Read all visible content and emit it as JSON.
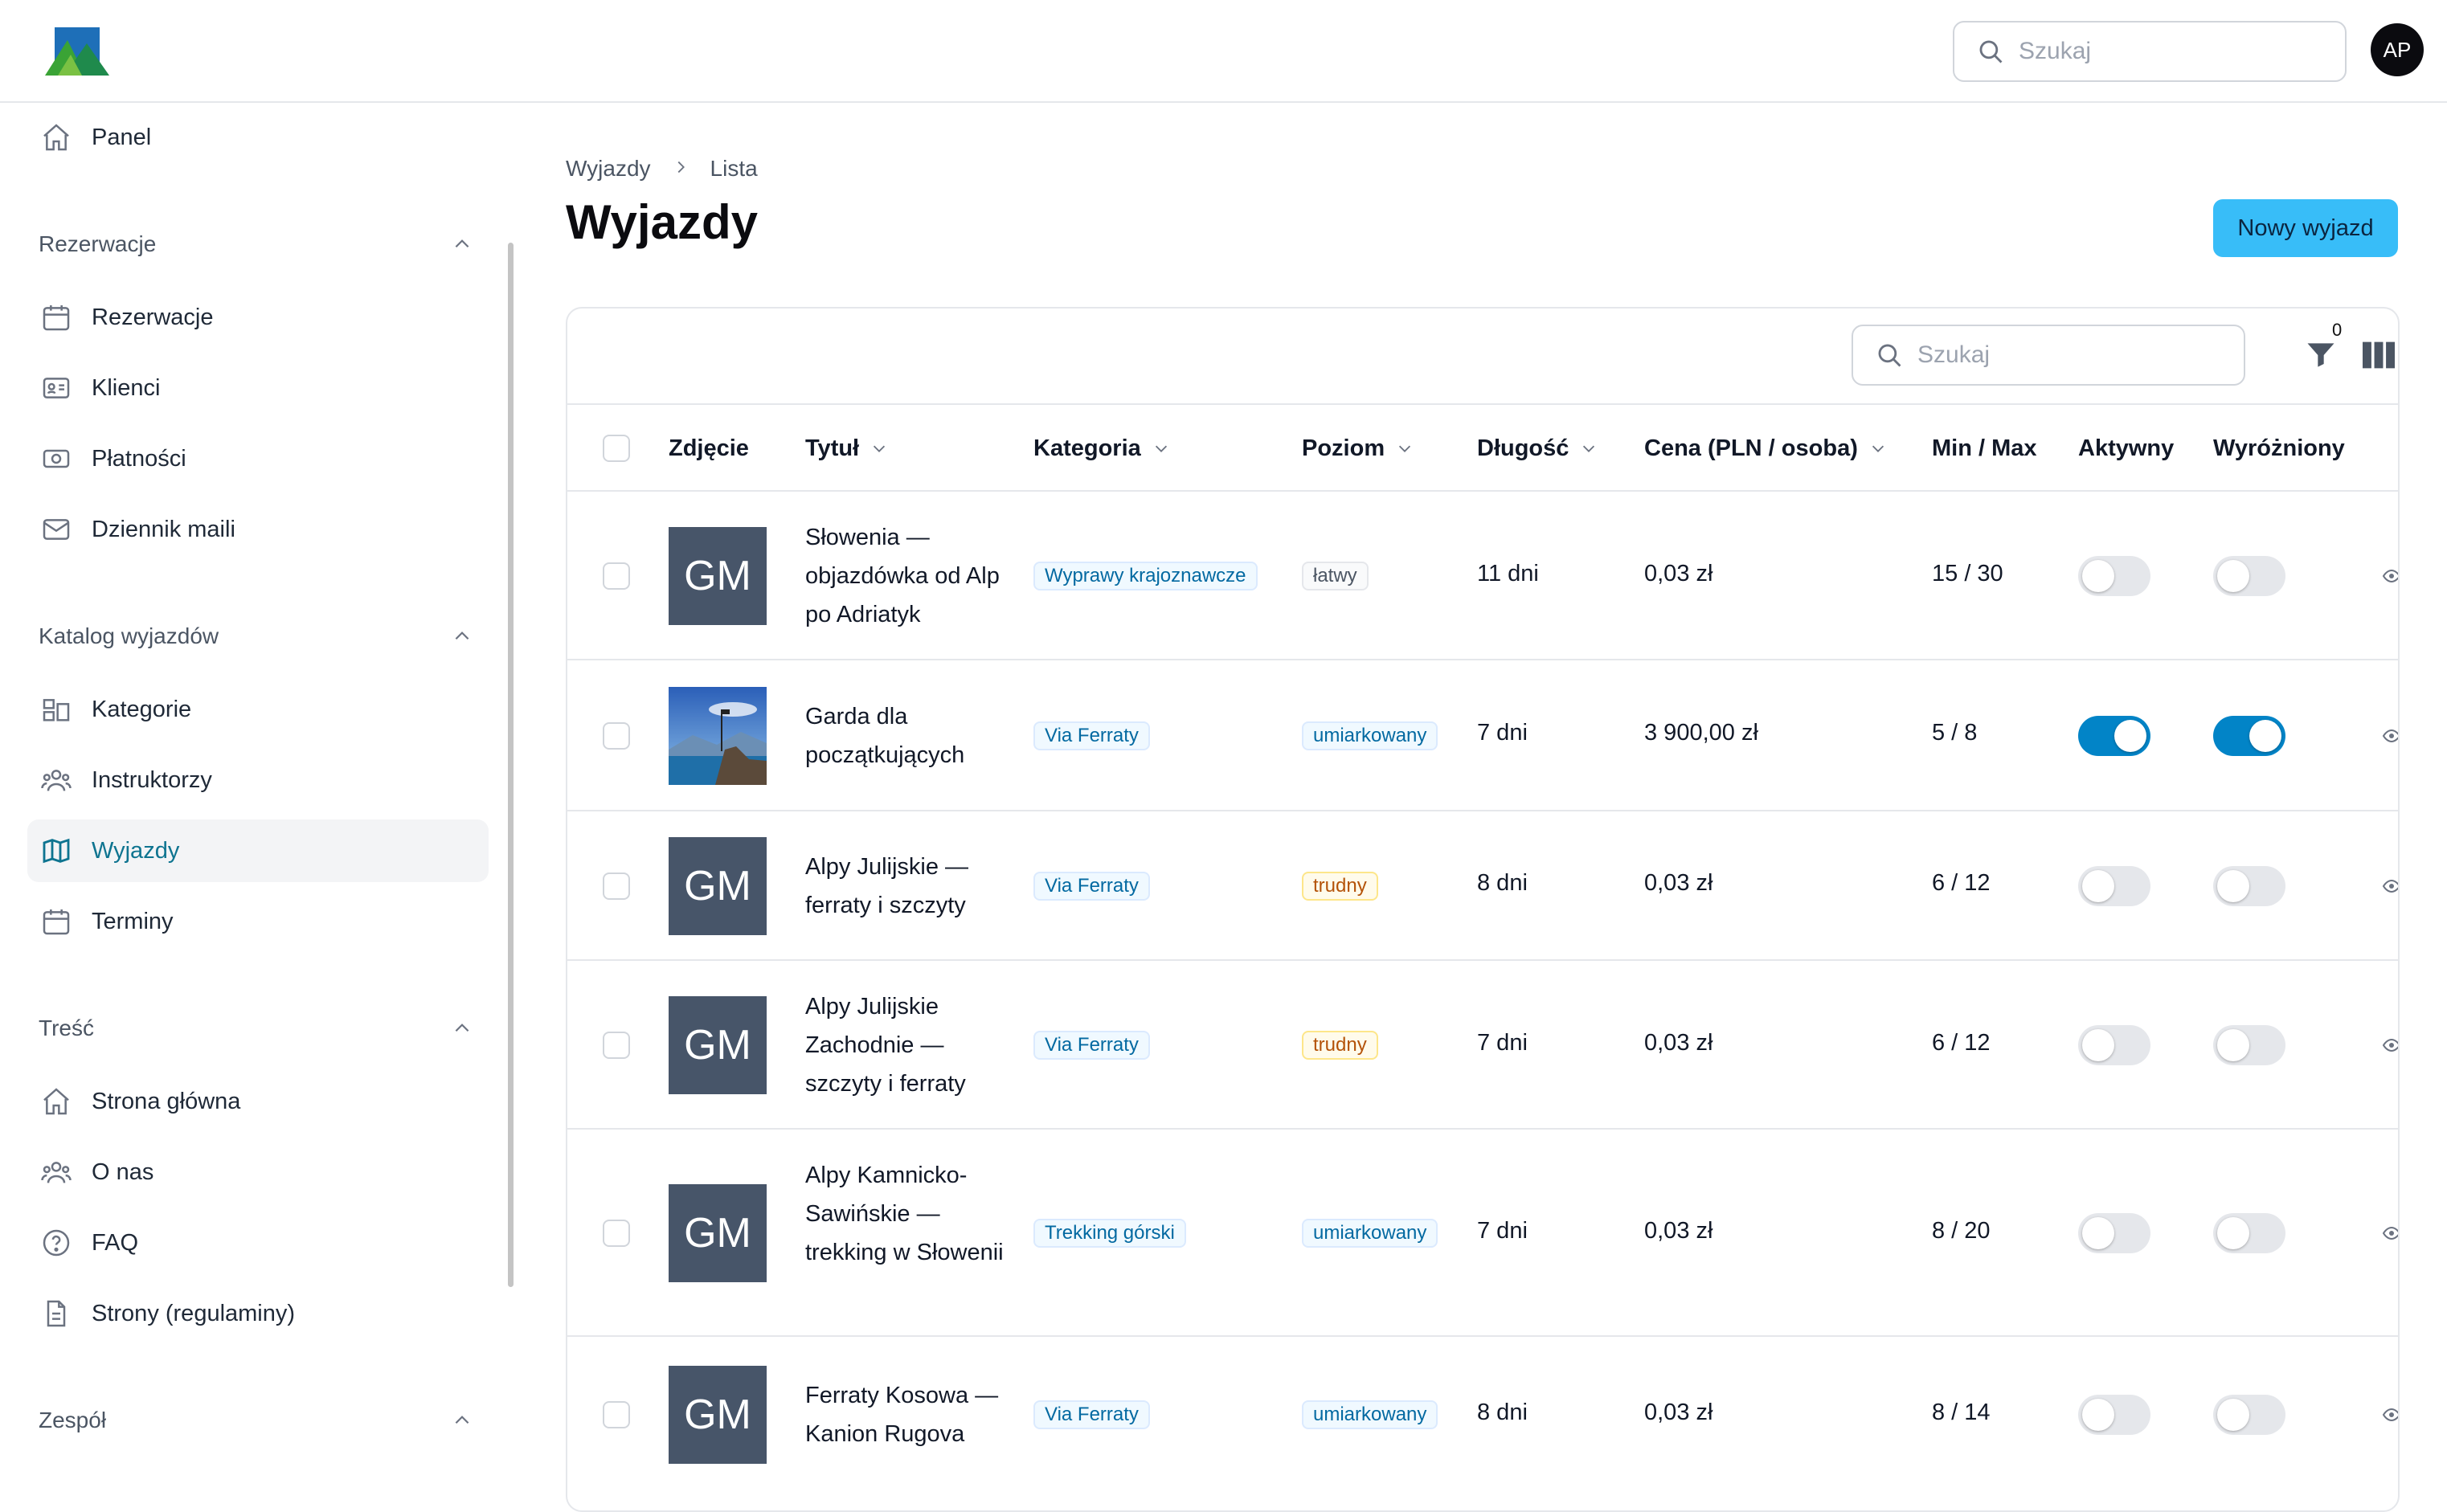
{
  "app": {
    "search_placeholder": "Szukaj",
    "avatar_initials": "AP"
  },
  "sidebar": {
    "panel_label": "Panel",
    "groups": [
      {
        "label": "Rezerwacje",
        "items": [
          {
            "label": "Rezerwacje",
            "icon": "calendar-icon"
          },
          {
            "label": "Klienci",
            "icon": "id-card-icon"
          },
          {
            "label": "Płatności",
            "icon": "banknote-icon"
          },
          {
            "label": "Dziennik maili",
            "icon": "envelope-icon"
          }
        ]
      },
      {
        "label": "Katalog wyjazdów",
        "items": [
          {
            "label": "Kategorie",
            "icon": "layout-icon"
          },
          {
            "label": "Instruktorzy",
            "icon": "users-icon"
          },
          {
            "label": "Wyjazdy",
            "icon": "map-icon",
            "active": true
          },
          {
            "label": "Terminy",
            "icon": "calendar-icon"
          }
        ]
      },
      {
        "label": "Treść",
        "items": [
          {
            "label": "Strona główna",
            "icon": "home-icon"
          },
          {
            "label": "O nas",
            "icon": "users-icon"
          },
          {
            "label": "FAQ",
            "icon": "question-icon"
          },
          {
            "label": "Strony (regulaminy)",
            "icon": "document-icon"
          }
        ]
      },
      {
        "label": "Zespół",
        "items": []
      }
    ]
  },
  "page": {
    "breadcrumb": [
      "Wyjazdy",
      "Lista"
    ],
    "title": "Wyjazdy",
    "new_button": "Nowy wyjazd"
  },
  "table": {
    "search_placeholder": "Szukaj",
    "filter_count": "0",
    "columns": [
      "Zdjęcie",
      "Tytuł",
      "Kategoria",
      "Poziom",
      "Długość",
      "Cena (PLN / osoba)",
      "Min / Max",
      "Aktywny",
      "Wyróżniony"
    ],
    "rows": [
      {
        "thumb": "GM",
        "title": "Słowenia — objazdówka od Alp po Adriatyk",
        "category": "Wyprawy krajoznawcze",
        "level": "łatwy",
        "length": "11 dni",
        "price": "0,03 zł",
        "minmax": "15 / 30",
        "active": false,
        "featured": false
      },
      {
        "thumb": "",
        "title": "Garda dla początkujących",
        "category": "Via Ferraty",
        "level": "umiarkowany",
        "length": "7 dni",
        "price": "3 900,00 zł",
        "minmax": "5 / 8",
        "active": true,
        "featured": true
      },
      {
        "thumb": "GM",
        "title": "Alpy Julijskie — ferraty i szczyty",
        "category": "Via Ferraty",
        "level": "trudny",
        "length": "8 dni",
        "price": "0,03 zł",
        "minmax": "6 / 12",
        "active": false,
        "featured": false
      },
      {
        "thumb": "GM",
        "title": "Alpy Julijskie Zachodnie — szczyty i ferraty",
        "category": "Via Ferraty",
        "level": "trudny",
        "length": "7 dni",
        "price": "0,03 zł",
        "minmax": "6 / 12",
        "active": false,
        "featured": false
      },
      {
        "thumb": "GM",
        "title": "Alpy Kamnicko-Sawińskie — trekking w Słowenii",
        "category": "Trekking górski",
        "level": "umiarkowany",
        "length": "7 dni",
        "price": "0,03 zł",
        "minmax": "8 / 20",
        "active": false,
        "featured": false
      },
      {
        "thumb": "GM",
        "title": "Ferraty Kosowa — Kanion Rugova",
        "category": "Via Ferraty",
        "level": "umiarkowany",
        "length": "8 dni",
        "price": "0,03 zł",
        "minmax": "8 / 14",
        "active": false,
        "featured": false
      }
    ]
  }
}
